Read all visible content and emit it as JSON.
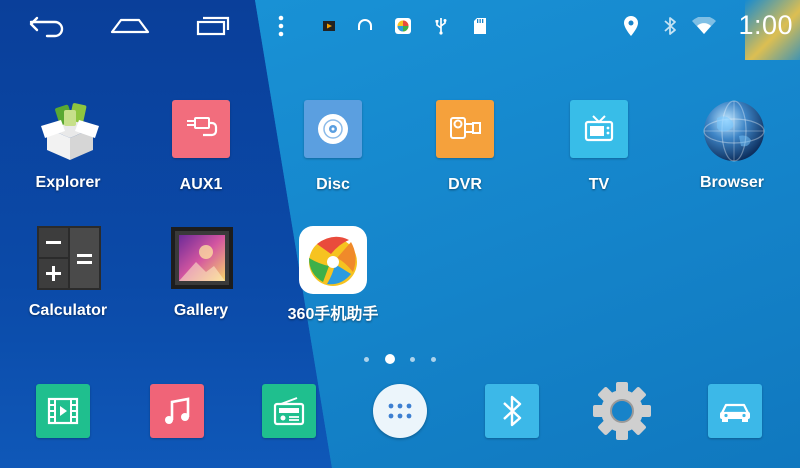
{
  "status_bar": {
    "nav_icons": [
      "back-icon",
      "home-icon",
      "recent-apps-icon",
      "overflow-menu-icon"
    ],
    "notification_icons": [
      "video-play-icon",
      "headset-icon",
      "360-app-icon",
      "usb-icon",
      "sd-card-icon"
    ],
    "system_icons": [
      "location-icon",
      "bluetooth-icon",
      "wifi-icon"
    ],
    "time": "1:00"
  },
  "apps": [
    {
      "label": "Explorer",
      "icon": "explorer-box-icon",
      "color": "#8ec63f"
    },
    {
      "label": "AUX1",
      "icon": "aux-cable-icon",
      "color": "#f26d7d"
    },
    {
      "label": "Disc",
      "icon": "disc-icon",
      "color": "#5b9fe0"
    },
    {
      "label": "DVR",
      "icon": "dvr-camera-icon",
      "color": "#f5a13c"
    },
    {
      "label": "TV",
      "icon": "tv-icon",
      "color": "#38bde8"
    },
    {
      "label": "Browser",
      "icon": "globe-icon",
      "color": "#1a4f88"
    },
    {
      "label": "Calculator",
      "icon": "calculator-icon",
      "color": "#3a3a3a"
    },
    {
      "label": "Gallery",
      "icon": "gallery-icon",
      "color": "#7a3fa0"
    },
    {
      "label": "360手机助手",
      "icon": "360-assistant-icon",
      "color": "#ffffff"
    }
  ],
  "pager": {
    "count": 4,
    "active": 1
  },
  "dock": [
    {
      "name": "video",
      "icon": "video-film-icon",
      "color": "#1fbf8e"
    },
    {
      "name": "music",
      "icon": "music-note-icon",
      "color": "#f06478"
    },
    {
      "name": "radio",
      "icon": "radio-icon",
      "color": "#1fbf8e"
    },
    {
      "name": "all-apps",
      "icon": "app-drawer-icon",
      "color": "#ffffff"
    },
    {
      "name": "bluetooth",
      "icon": "bluetooth-icon",
      "color": "#3cb8e8"
    },
    {
      "name": "settings",
      "icon": "settings-gear-icon",
      "color": "#c9c9c9"
    },
    {
      "name": "car",
      "icon": "car-icon",
      "color": "#3cb8e8"
    }
  ]
}
